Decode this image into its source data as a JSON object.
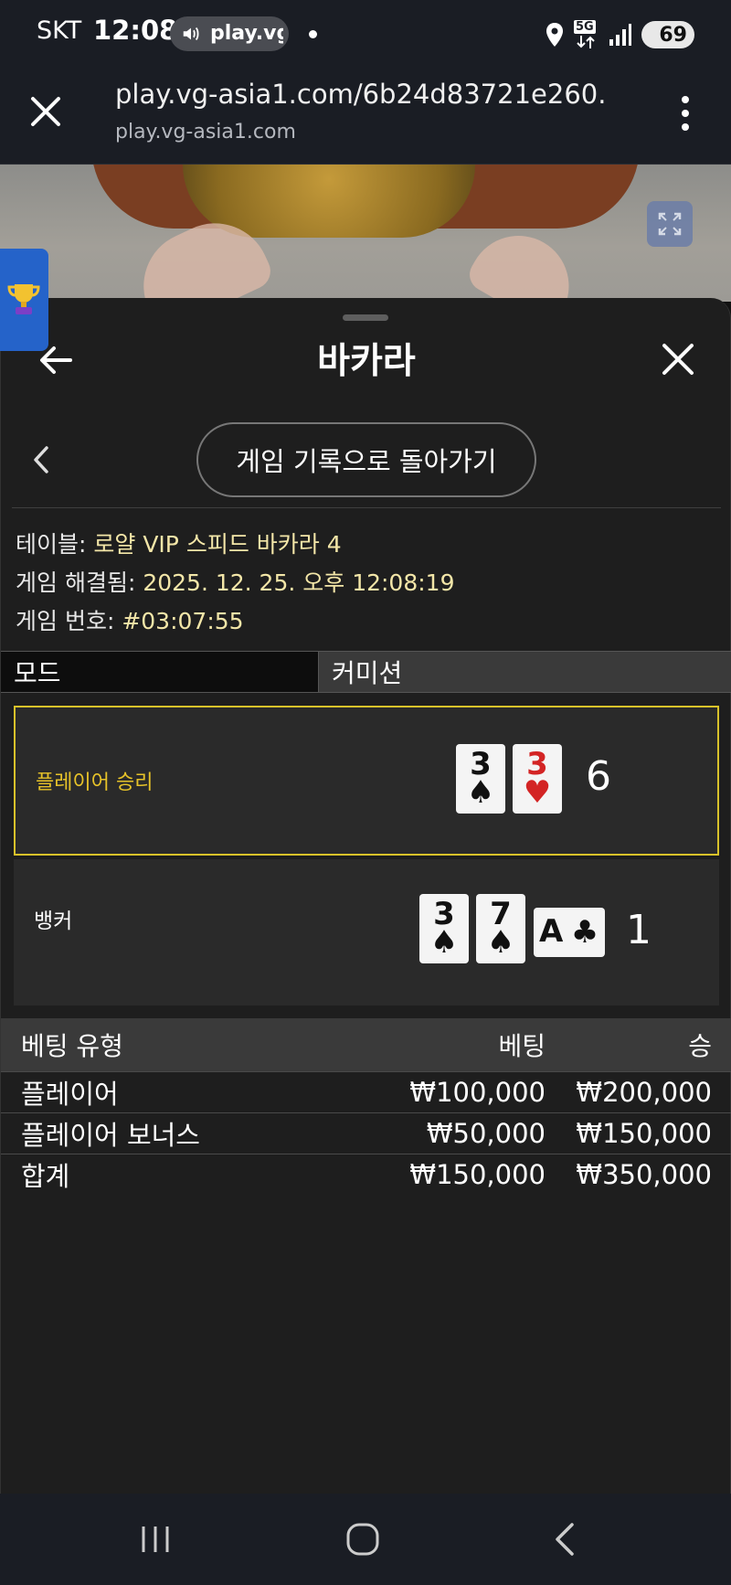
{
  "status_bar": {
    "carrier": "SKT",
    "time": "12:08",
    "media_chip_text": "play.vg",
    "network": "5G",
    "battery": "69"
  },
  "browser": {
    "url": "play.vg-asia1.com/6b24d83721e260...",
    "domain": "play.vg-asia1.com"
  },
  "sheet": {
    "title": "바카라",
    "history_button": "게임 기록으로 돌아가기",
    "info": {
      "table_label": "테이블: ",
      "table_value": "로얄 VIP 스피드 바카라 4",
      "resolved_label": "게임 해결됨: ",
      "resolved_value": "2025. 12. 25. 오후 12:08:19",
      "game_no_label": "게임 번호: ",
      "game_no_value": "#03:07:55"
    },
    "mode": {
      "label": "모드",
      "value": "커미션"
    },
    "player": {
      "label": "플레이어 승리",
      "label_color": "#e6c229",
      "cards": [
        {
          "rank": "3",
          "suit": "♠",
          "color": "black"
        },
        {
          "rank": "3",
          "suit": "♥",
          "color": "red"
        }
      ],
      "score": "6"
    },
    "banker": {
      "label": "뱅커",
      "cards": [
        {
          "rank": "3",
          "suit": "♠",
          "color": "black"
        },
        {
          "rank": "7",
          "suit": "♠",
          "color": "black"
        },
        {
          "rank": "A",
          "suit": "♣",
          "color": "black",
          "sideways": true
        }
      ],
      "score": "1"
    },
    "bets": {
      "headers": [
        "베팅 유형",
        "베팅",
        "승"
      ],
      "rows": [
        {
          "type": "플레이어",
          "bet": "₩100,000",
          "win": "₩200,000"
        },
        {
          "type": "플레이어 보너스",
          "bet": "₩50,000",
          "win": "₩150,000"
        }
      ],
      "total": {
        "type": "합계",
        "bet": "₩150,000",
        "win": "₩350,000"
      }
    }
  },
  "colors": {
    "accent_gold": "#e6c229",
    "value_cream": "#f3e6a8",
    "win_border": "#d8c22a"
  }
}
